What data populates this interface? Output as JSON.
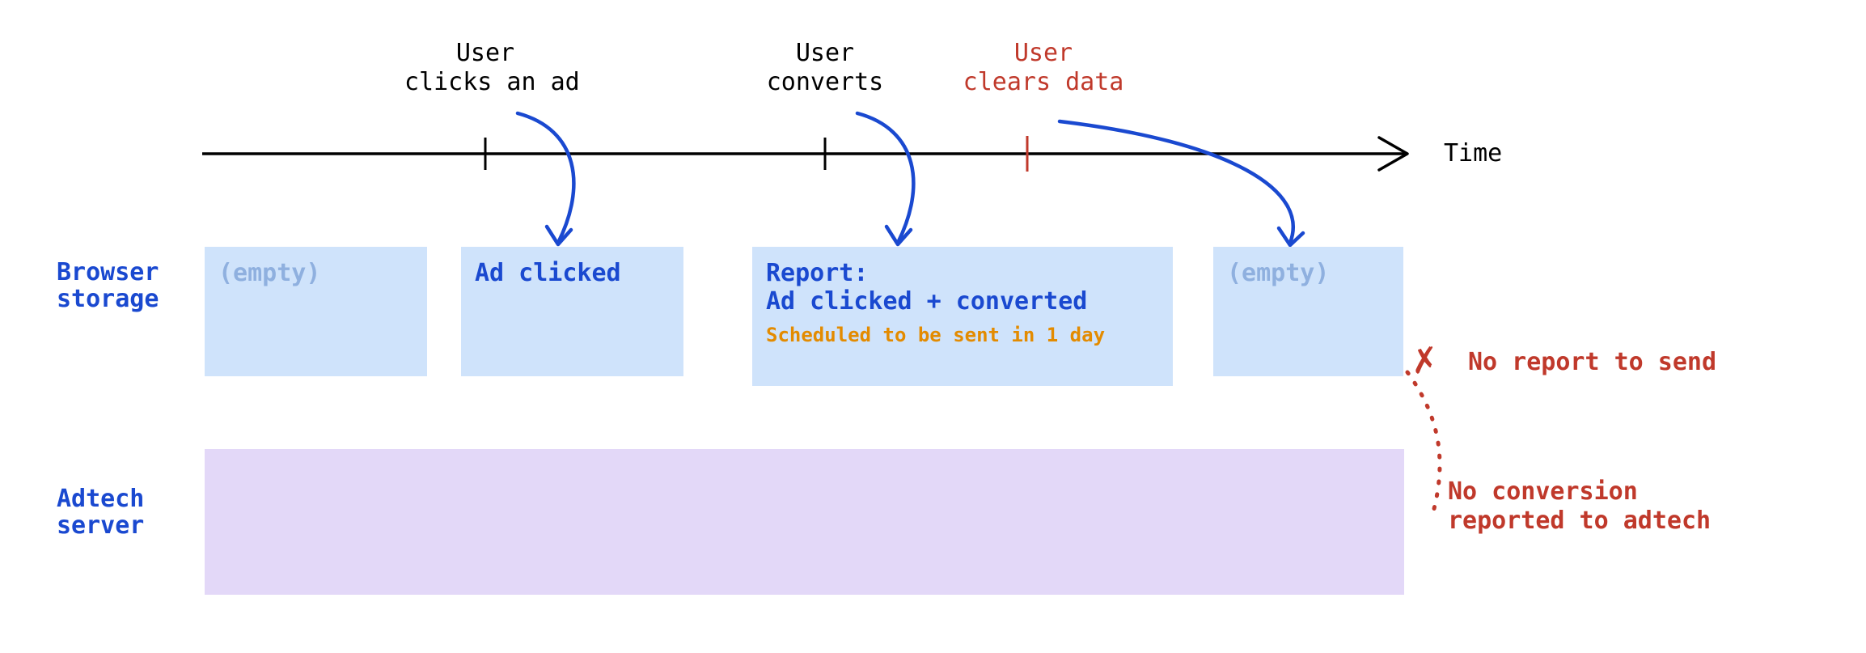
{
  "timeline": {
    "axis_label": "Time",
    "events": [
      {
        "label": "User\nclicks an ad",
        "color": "black"
      },
      {
        "label": "User\nconverts",
        "color": "black"
      },
      {
        "label": "User\nclears data",
        "color": "red"
      }
    ]
  },
  "rows": {
    "browser_storage_label": "Browser\nstorage",
    "adtech_server_label": "Adtech\nserver"
  },
  "storage": {
    "box1": "(empty)",
    "box2": "Ad clicked",
    "box3_title": "Report:",
    "box3_body": "Ad clicked + converted",
    "box3_note": "Scheduled to be sent in 1 day",
    "box4": "(empty)"
  },
  "errors": {
    "no_report": "No report to send",
    "no_conversion": "No conversion\nreported to adtech"
  }
}
